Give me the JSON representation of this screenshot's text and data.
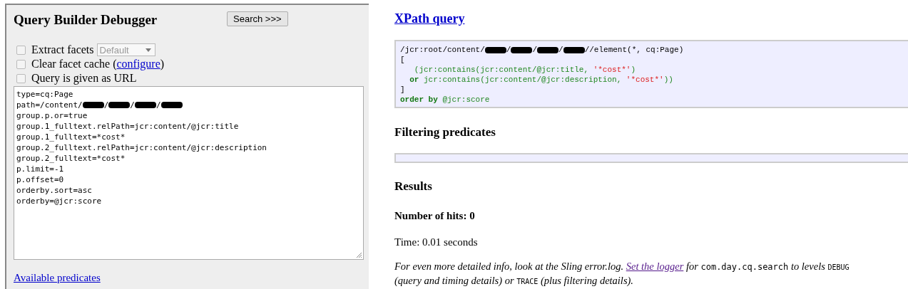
{
  "panel": {
    "title": "Query Builder Debugger",
    "search_button": "Search >>>",
    "options": [
      {
        "kind": "select",
        "label": "Extract facets",
        "checked": false,
        "select": {
          "value": "Default",
          "disabled": true
        }
      },
      {
        "kind": "link",
        "label": "Clear facet cache (",
        "link": "configure",
        "suffix": ")",
        "checked": false
      },
      {
        "kind": "plain",
        "label": "Query is given as URL",
        "checked": false
      }
    ],
    "query_lines": [
      [
        {
          "kind": "text",
          "text": "type=cq:Page"
        }
      ],
      [
        {
          "kind": "text",
          "text": "path=/content/"
        },
        {
          "kind": "redacted"
        },
        {
          "kind": "text",
          "text": "/"
        },
        {
          "kind": "redacted"
        },
        {
          "kind": "text",
          "text": "/"
        },
        {
          "kind": "redacted"
        },
        {
          "kind": "text",
          "text": "/"
        },
        {
          "kind": "redacted"
        }
      ],
      [
        {
          "kind": "text",
          "text": "group.p.or=true"
        }
      ],
      [
        {
          "kind": "text",
          "text": "group.1_fulltext.relPath=jcr:content/@jcr:title"
        }
      ],
      [
        {
          "kind": "text",
          "text": "group.1_fulltext=*cost*"
        }
      ],
      [
        {
          "kind": "text",
          "text": "group.2_fulltext.relPath=jcr:content/@jcr:description"
        }
      ],
      [
        {
          "kind": "text",
          "text": "group.2_fulltext=*cost*"
        }
      ],
      [
        {
          "kind": "text",
          "text": "p.limit=-1"
        }
      ],
      [
        {
          "kind": "text",
          "text": "p.offset=0"
        }
      ],
      [
        {
          "kind": "text",
          "text": "orderby.sort=asc"
        }
      ],
      [
        {
          "kind": "text",
          "text": "orderby=@jcr:score"
        }
      ]
    ],
    "predicates_link": "Available predicates"
  },
  "xpath": {
    "heading": "XPath query",
    "lines": [
      [
        {
          "kind": "text",
          "text": "/jcr:root/content/"
        },
        {
          "kind": "redacted"
        },
        {
          "kind": "text",
          "text": "/"
        },
        {
          "kind": "redacted"
        },
        {
          "kind": "text",
          "text": "/"
        },
        {
          "kind": "redacted"
        },
        {
          "kind": "text",
          "text": "/"
        },
        {
          "kind": "redacted"
        },
        {
          "kind": "text",
          "text": "//element(*, cq:Page)"
        }
      ],
      [
        {
          "kind": "text",
          "text": "["
        }
      ],
      [
        {
          "kind": "fn",
          "text": "   (jcr:contains(jcr:content/@jcr:title, "
        },
        {
          "kind": "string",
          "text": "'*cost*'"
        },
        {
          "kind": "fn",
          "text": ")"
        }
      ],
      [
        {
          "kind": "keyword",
          "text": "  or"
        },
        {
          "kind": "fn",
          "text": " jcr:contains(jcr:content/@jcr:description, "
        },
        {
          "kind": "string",
          "text": "'*cost*'"
        },
        {
          "kind": "fn",
          "text": "))"
        }
      ],
      [
        {
          "kind": "text",
          "text": "]"
        }
      ],
      [
        {
          "kind": "keyword",
          "text": "order by"
        },
        {
          "kind": "fn",
          "text": " @jcr:score"
        }
      ]
    ]
  },
  "filtering": {
    "heading": "Filtering predicates"
  },
  "results": {
    "heading": "Results",
    "hits": "Number of hits: 0",
    "time": "Time: 0.01 seconds",
    "note": [
      {
        "kind": "text",
        "text": "For even more detailed info, look at the Sling error.log. "
      },
      {
        "kind": "link",
        "text": "Set the logger"
      },
      {
        "kind": "text",
        "text": " for "
      },
      {
        "kind": "code",
        "text": "com.day.cq.search"
      },
      {
        "kind": "text",
        "text": " to levels "
      },
      {
        "kind": "smallcode",
        "text": "DEBUG"
      },
      {
        "kind": "text",
        "text": " (query and timing details) or "
      },
      {
        "kind": "smallcode",
        "text": "TRACE"
      },
      {
        "kind": "text",
        "text": " (plus filtering details)."
      }
    ]
  }
}
